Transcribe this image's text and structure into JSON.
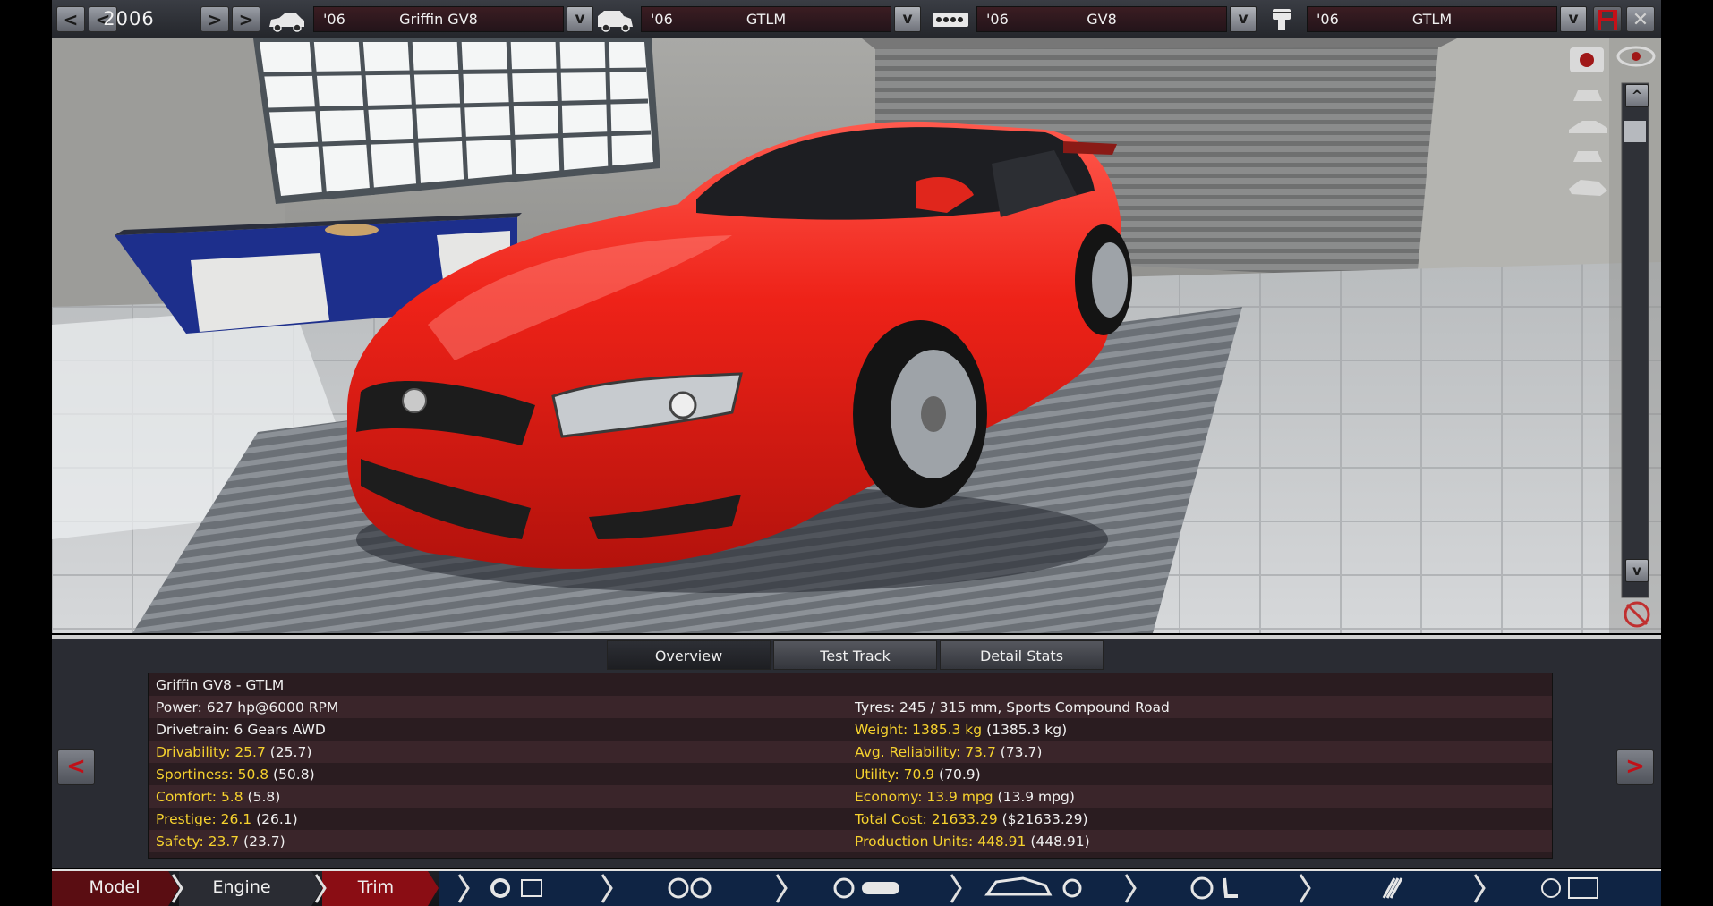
{
  "topbar": {
    "year": "2006",
    "prev_fast": "<",
    "prev": "<",
    "next": ">",
    "next_fast": ">",
    "selectors": [
      {
        "year": "'06",
        "name": "Griffin GV8"
      },
      {
        "year": "'06",
        "name": "GTLM"
      },
      {
        "year": "'06",
        "name": "GV8"
      },
      {
        "year": "'06",
        "name": "GTLM"
      }
    ],
    "dropdown": "v",
    "close": "✕"
  },
  "viewport": {
    "scroll_up": "^",
    "scroll_down": "v"
  },
  "tabs": [
    "Overview",
    "Test Track",
    "Detail Stats"
  ],
  "stats": {
    "title": "Griffin GV8 - GTLM",
    "power": "Power: 627 hp@6000 RPM",
    "drivetrain": "Drivetrain: 6 Gears AWD",
    "tyres": "Tyres: 245 / 315 mm, Sports Compound Road",
    "left": [
      {
        "label": "Drivability: 25.7",
        "extra": " (25.7)"
      },
      {
        "label": "Sportiness: 50.8",
        "extra": " (50.8)"
      },
      {
        "label": "Comfort: 5.8",
        "extra": " (5.8)"
      },
      {
        "label": "Prestige: 26.1",
        "extra": " (26.1)"
      },
      {
        "label": "Safety: 23.7",
        "extra": " (23.7)"
      }
    ],
    "right": [
      {
        "label": "Weight: 1385.3 kg",
        "extra": " (1385.3 kg)"
      },
      {
        "label": "Avg. Reliability: 73.7",
        "extra": " (73.7)"
      },
      {
        "label": "Utility: 70.9",
        "extra": " (70.9)"
      },
      {
        "label": "Economy: 13.9 mpg",
        "extra": " (13.9 mpg)"
      },
      {
        "label": "Total Cost: 21633.29",
        "extra": " ($21633.29)"
      },
      {
        "label": "Production Units: 448.91",
        "extra": " (448.91)"
      }
    ]
  },
  "nav": {
    "prev": "<",
    "next": ">",
    "items": [
      "Model",
      "Engine",
      "Trim"
    ]
  },
  "colors": {
    "accent_yellow": "#f6d22e",
    "car_red": "#e8201c",
    "tab_red": "#c01018"
  }
}
